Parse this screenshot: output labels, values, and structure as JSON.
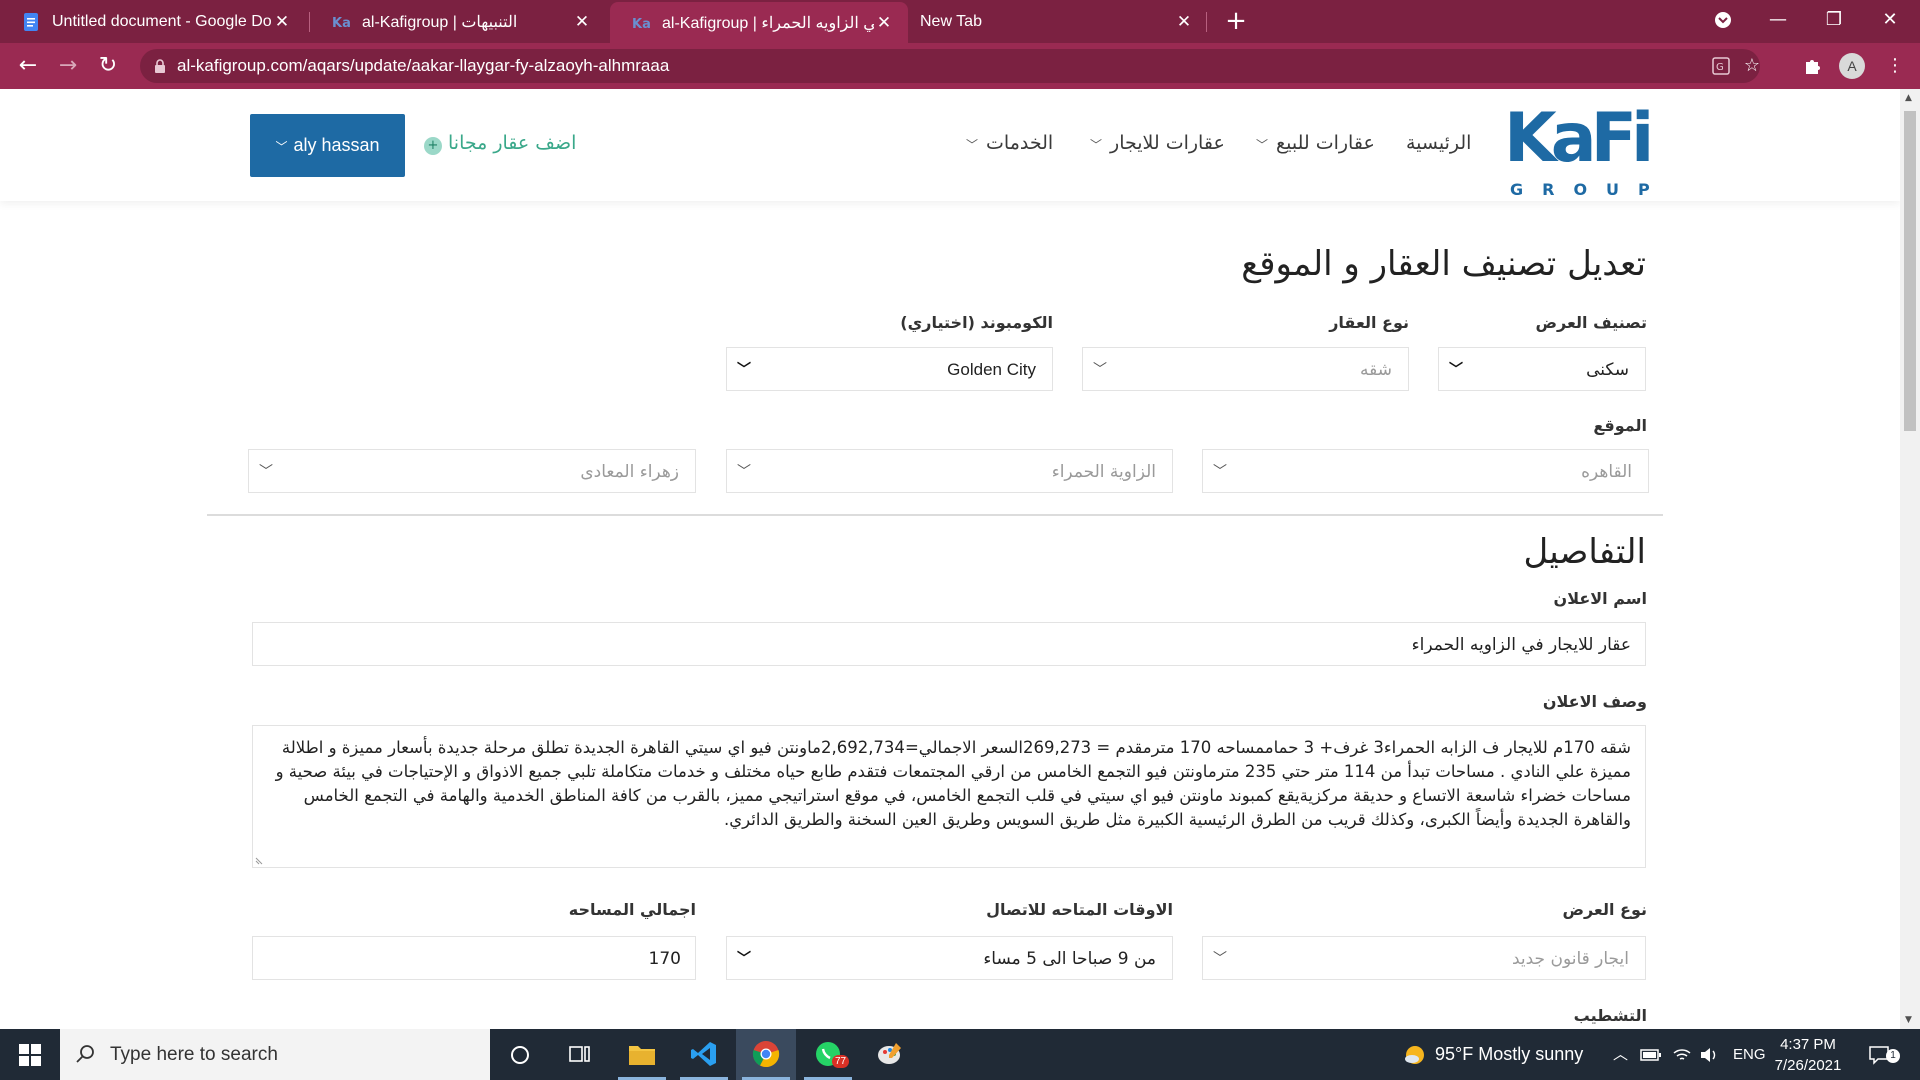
{
  "browser": {
    "tabs": [
      {
        "title": "Untitled document - Google Doc",
        "icon": "google-docs-icon",
        "active": false
      },
      {
        "title": "al-Kafigroup | التنبيهات",
        "icon": "kafi-favicon",
        "active": false
      },
      {
        "title": "al-Kafigroup | ار في الزاويه الحمراء",
        "icon": "kafi-favicon",
        "active": true
      },
      {
        "title": "New Tab",
        "icon": "",
        "active": false
      }
    ],
    "url": "al-kafigroup.com/aqars/update/aakar-llaygar-fy-alzaoyh-alhmraaa",
    "profile_initial": "A",
    "accent": "#9a2a52"
  },
  "header": {
    "logo_text": "KaFi",
    "logo_sub": "GROUP",
    "nav": {
      "home": "الرئيسية",
      "for_sale": "عقارات للبيع",
      "for_rent": "عقارات للايجار",
      "services": "الخدمات"
    },
    "add_free": "اضف عقار مجانا",
    "user": "aly hassan"
  },
  "section1": {
    "title": "تعديل تصنيف العقار و الموقع",
    "offer_category": {
      "label": "تصنيف العرض",
      "value": "سكنى"
    },
    "property_type": {
      "label": "نوع العقار",
      "value": "شقه"
    },
    "compound": {
      "label": "الكومبوند (اختياري)",
      "value": "Golden City"
    },
    "location": {
      "label": "الموقع",
      "city": "القاهره",
      "district": "الزاوية الحمراء",
      "area": "زهراء المعادى"
    }
  },
  "section2": {
    "title": "التفاصيل",
    "ad_name": {
      "label": "اسم الاعلان",
      "value": "عقار للايجار في الزاويه الحمراء"
    },
    "ad_desc": {
      "label": "وصف الاعلان",
      "value": "شقه 170م للايجار ف الزابه الحمراء3 غرف+ 3 حماممساحه 170 مترمقدم = 269,273السعر الاجمالي=2,692,734ماونتن فيو اي سيتي القاهرة الجديدة تطلق مرحلة جديدة بأسعار مميزة و اطلالة مميزة علي النادي . مساحات تبدأ من 114 متر حتي 235 مترماونتن فيو التجمع الخامس من ارقي المجتمعات فتقدم طابع حياه مختلف و خدمات متكاملة تلبي جميع الاذواق و الإحتياجات في بيئة صحية و مساحات خضراء شاسعة الاتساع و حديقة مركزيةيقع كمبوند ماونتن فيو اي سيتي في قلب التجمع الخامس، في موقع استراتيجي مميز، بالقرب من كافة المناطق الخدمية والهامة في التجمع الخامس والقاهرة الجديدة وأيضاً الكبرى، وكذلك قريب من الطرق الرئيسية الكبيرة مثل طريق السويس وطريق العين السخنة والطريق الدائري."
    },
    "offer_type": {
      "label": "نوع العرض",
      "value": "ايجار قانون جديد"
    },
    "contact_times": {
      "label": "الاوقات المتاحه للاتصال",
      "value": "من 9 صباحا الى 5 مساء"
    },
    "total_area": {
      "label": "اجمالي المساحه",
      "value": "170"
    },
    "finishing": {
      "label": "التشطيب"
    }
  },
  "taskbar": {
    "search_placeholder": "Type here to search",
    "weather": "95°F  Mostly sunny",
    "lang": "ENG",
    "time": "4:37 PM",
    "date": "7/26/2021",
    "whatsapp_badge": "77",
    "notif_count": "1"
  }
}
